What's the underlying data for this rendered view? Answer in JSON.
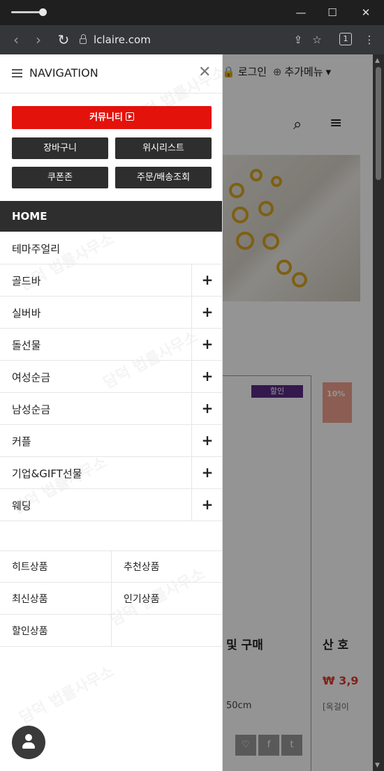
{
  "browser": {
    "url": "lclaire.com",
    "tab_count": "1",
    "icons": [
      "minimize-icon",
      "maximize-icon",
      "close-icon",
      "back-icon",
      "forward-icon",
      "reload-icon",
      "lock-icon",
      "share-icon",
      "bookmark-icon",
      "tabs-icon",
      "more-icon"
    ]
  },
  "background_page": {
    "top_links": [
      "로그인",
      "추가메뉴"
    ],
    "sale_badge": "할인",
    "discount_tag": "10%",
    "product_title_fragment": "및 구매",
    "product_title_fragment2": "산 호",
    "price_fragment": "₩ 3,9",
    "size_text": "50cm",
    "desc_fragment": "[옥걸이"
  },
  "drawer": {
    "title": "NAVIGATION",
    "community_button": "커뮤니티",
    "buttons": [
      "장바구니",
      "위시리스트",
      "쿠폰존",
      "주문/배송조회"
    ],
    "home": "HOME",
    "menu": [
      {
        "label": "테마주얼리",
        "expandable": false
      },
      {
        "label": "골드바",
        "expandable": true
      },
      {
        "label": "실버바",
        "expandable": true
      },
      {
        "label": "돌선물",
        "expandable": true
      },
      {
        "label": "여성순금",
        "expandable": true
      },
      {
        "label": "남성순금",
        "expandable": true
      },
      {
        "label": "커플",
        "expandable": true
      },
      {
        "label": "기업&GIFT선물",
        "expandable": true
      },
      {
        "label": "웨딩",
        "expandable": true
      }
    ],
    "quick_links": [
      "히트상품",
      "추천상품",
      "최신상품",
      "인기상품",
      "할인상품"
    ]
  }
}
